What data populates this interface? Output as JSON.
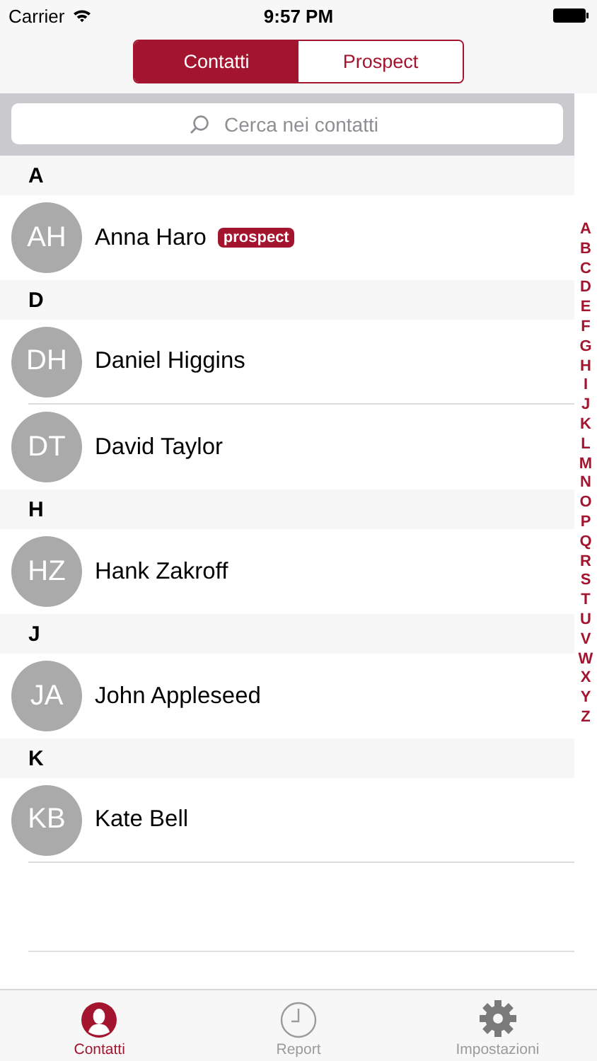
{
  "status_bar": {
    "carrier": "Carrier",
    "time": "9:57 PM"
  },
  "segments": [
    {
      "label": "Contatti",
      "selected": true
    },
    {
      "label": "Prospect",
      "selected": false
    }
  ],
  "search": {
    "placeholder": "Cerca nei contatti"
  },
  "sections": [
    {
      "letter": "A",
      "contacts": [
        {
          "initials": "AH",
          "name": "Anna Haro",
          "badge": "prospect"
        }
      ]
    },
    {
      "letter": "D",
      "contacts": [
        {
          "initials": "DH",
          "name": "Daniel Higgins"
        },
        {
          "initials": "DT",
          "name": "David Taylor"
        }
      ]
    },
    {
      "letter": "H",
      "contacts": [
        {
          "initials": "HZ",
          "name": "Hank Zakroff"
        }
      ]
    },
    {
      "letter": "J",
      "contacts": [
        {
          "initials": "JA",
          "name": "John Appleseed"
        }
      ]
    },
    {
      "letter": "K",
      "contacts": [
        {
          "initials": "KB",
          "name": "Kate Bell"
        }
      ]
    }
  ],
  "index": [
    "A",
    "B",
    "C",
    "D",
    "E",
    "F",
    "G",
    "H",
    "I",
    "J",
    "K",
    "L",
    "M",
    "N",
    "O",
    "P",
    "Q",
    "R",
    "S",
    "T",
    "U",
    "V",
    "W",
    "X",
    "Y",
    "Z"
  ],
  "tab_bar": [
    {
      "label": "Contatti",
      "kind": "person",
      "selected": true
    },
    {
      "label": "Report",
      "kind": "clock",
      "selected": false
    },
    {
      "label": "Impostazioni",
      "kind": "gear",
      "selected": false
    }
  ]
}
